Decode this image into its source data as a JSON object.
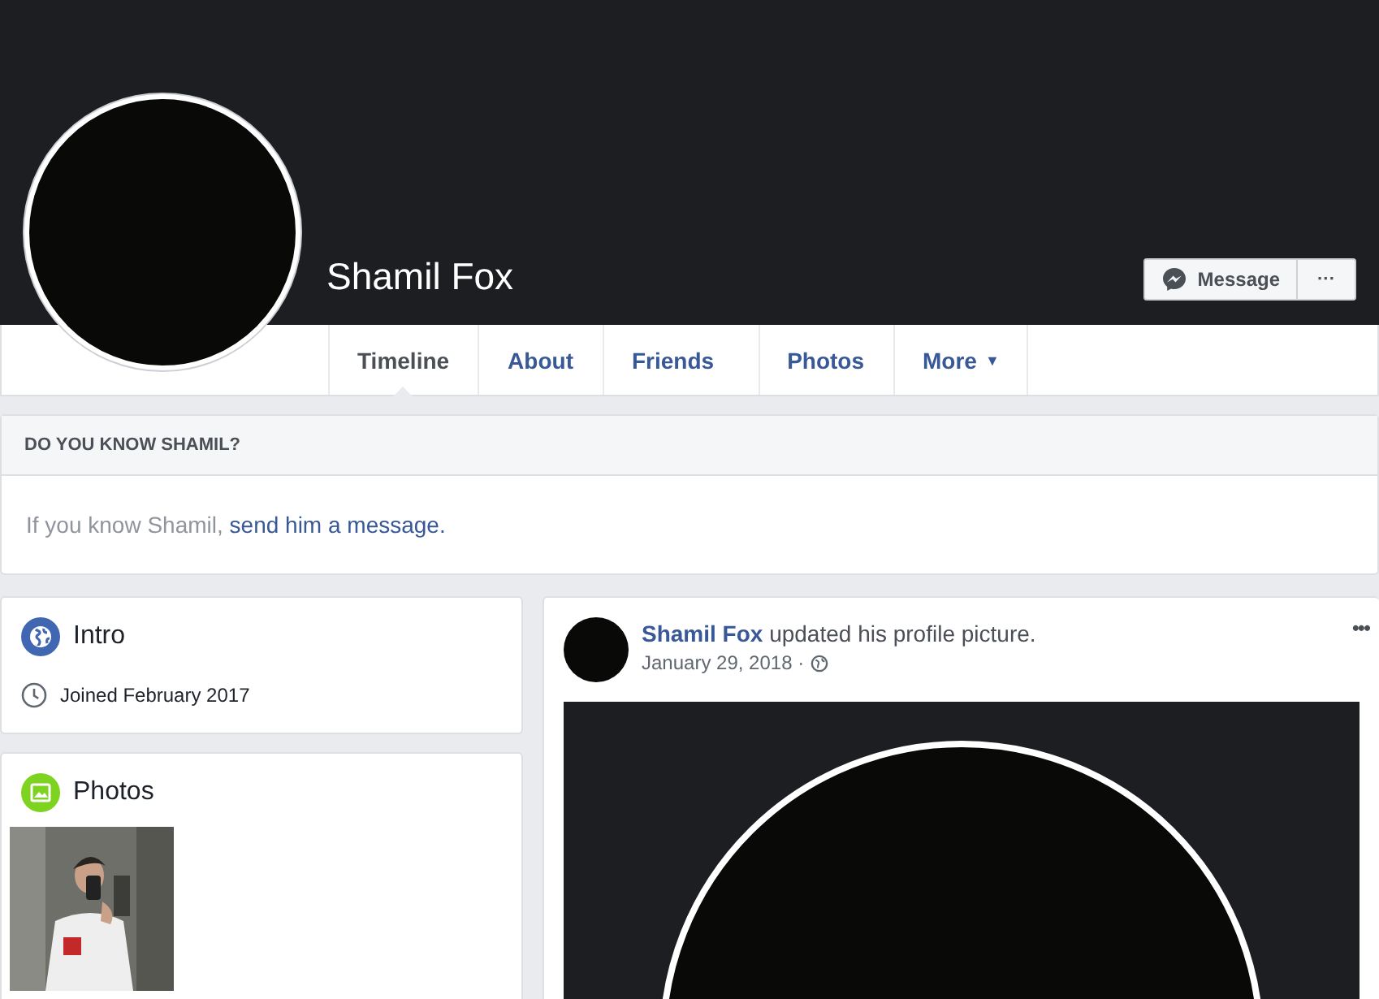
{
  "profile": {
    "name": "Shamil Fox"
  },
  "actions": {
    "message": "Message",
    "more": "···"
  },
  "tabs": [
    {
      "label": "Timeline",
      "selected": true
    },
    {
      "label": "About",
      "selected": false
    },
    {
      "label": "Friends",
      "selected": false
    },
    {
      "label": "Photos",
      "selected": false
    },
    {
      "label": "More",
      "selected": false,
      "caret": "▼"
    }
  ],
  "know_panel": {
    "title": "DO YOU KNOW SHAMIL?",
    "text": "If you know Shamil,",
    "link": "send him a message."
  },
  "intro": {
    "title": "Intro",
    "joined": "Joined February 2017"
  },
  "photos": {
    "title": "Photos"
  },
  "post": {
    "author": "Shamil Fox",
    "action": "updated his profile picture.",
    "date": "January 29, 2018 ·",
    "menu": "•••"
  }
}
